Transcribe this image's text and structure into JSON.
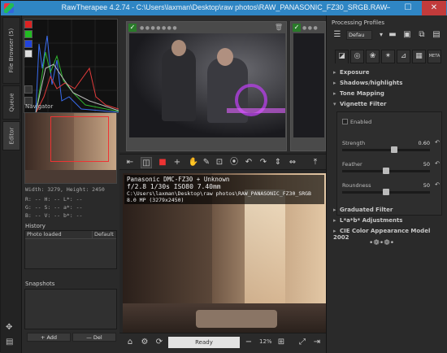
{
  "window": {
    "title": "RawTherapee 4.2.74 - C:\\Users\\laxman\\Desktop\\raw photos\\RAW_PANASONIC_FZ30_SRGB.RAW",
    "min": "–",
    "max": "☐",
    "close": "✕"
  },
  "vtabs": {
    "file_browser": "File Browser (5)",
    "queue": "Queue",
    "editor": "Editor"
  },
  "left": {
    "navigator_title": "Navigator",
    "nav_info": {
      "size": "Width: 3279, Height: 2450",
      "row1": "R:  --   H:  --   L*: --",
      "row2": "G:  --   S:  --   a*: --",
      "row3": "B:  --   V:  --   b*: --"
    },
    "history_title": "History",
    "history_entry": "Photo loaded",
    "history_entry_value": "Default",
    "snapshots_title": "Snapshots",
    "add_label": "+ Add",
    "del_label": "— Del"
  },
  "preview": {
    "line1": "Panasonic DMC-FZ30 + Unknown",
    "line2": "f/2.8  1/30s  ISO80  7.40mm",
    "line3": "C:\\Users\\laxman\\Desktop\\raw photos\\RAW_PANASONIC_FZ30_SRGB",
    "line4": "8.0 MP (3279x2450)"
  },
  "status": {
    "ready": "Ready",
    "zoom": "12%"
  },
  "right": {
    "processing_profiles": "Processing Profiles",
    "profile_value": "Defau",
    "meta_tab": "META",
    "tools": {
      "exposure": "Exposure",
      "shadows": "Shadows/highlights",
      "tone": "Tone Mapping",
      "vignette": "Vignette Filter",
      "graduated": "Graduated Filter",
      "lab": "L*a*b* Adjustments",
      "ciecam": "CIE Color Appearance Model 2002"
    },
    "vignette": {
      "enabled": "Enabled",
      "strength_label": "Strength",
      "strength_value": "0.60",
      "strength_level": 0.6,
      "feather_label": "Feather",
      "feather_value": "50",
      "feather_level": 0.5,
      "roundness_label": "Roundness",
      "roundness_value": "50",
      "roundness_level": 0.5
    },
    "ornament": "•❁•❁•"
  }
}
